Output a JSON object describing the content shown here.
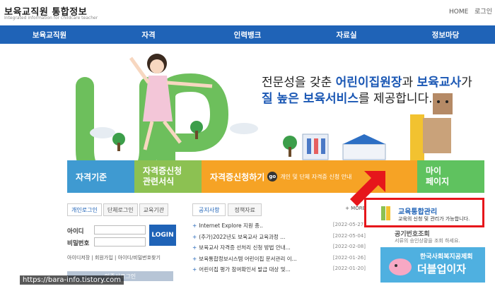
{
  "header": {
    "title": "보육교직원 통합정보",
    "subtitle": "Integrated information for childcare teacher",
    "links": [
      "HOME",
      "로그인"
    ]
  },
  "nav": {
    "items": [
      "보육교직원",
      "자격",
      "인력뱅크",
      "자료실",
      "정보마당"
    ]
  },
  "hero": {
    "line1_pre": "전문성을 갖춘 ",
    "line1_b1": "어린이집원장",
    "line1_mid": "과 ",
    "line1_b2": "보육교사",
    "line1_post": "가",
    "line2_b": "질 높은 보육서비스",
    "line2_post": "를 제공합니다."
  },
  "tabs": {
    "tab1": "자격기준",
    "tab2_line1": "자격증신청",
    "tab2_line2": "관련서식",
    "tab3": "자격증신청하기",
    "tab3_go": "go",
    "tab3_small": "개인 및 단체 자격증 신청 안내",
    "tab4_line1": "마이",
    "tab4_line2": "페이지"
  },
  "login": {
    "tabs": [
      "개인로그인",
      "단체로그인",
      "교육기관"
    ],
    "id_label": "아이디",
    "pw_label": "비밀번호",
    "button": "LOGIN",
    "links": "아이디저장 | 회원가입 | 아이디/비밀번호찾기",
    "cert_button": "인증서로그인"
  },
  "notices": {
    "tabs": [
      "공지사항",
      "정책자료"
    ],
    "more": "+ MORE",
    "items": [
      {
        "title": "Internet Explore 지원 종..",
        "date": "[2022-05-27]"
      },
      {
        "title": "(추가)2022년도 보육교사 교육과정 ...",
        "date": "[2022-05-04]"
      },
      {
        "title": "보육교사 자격증 선처리 신청 방법 안내...",
        "date": "[2022-02-08]"
      },
      {
        "title": "보육통합정보시스템 어린이집 문서관리 이...",
        "date": "[2022-01-26]"
      },
      {
        "title": "어린이집 평가 참여확인서 발급 대상 및...",
        "date": "[2022-01-20]"
      }
    ]
  },
  "right": {
    "edu_title": "교육통합관리",
    "edu_desc": "교육의 신청 및 관리가 가능합니다.",
    "sub_title": "공기번호조회",
    "sub_desc": "서류의 승인상황을 조회 하세요.",
    "fund_line1": "한국사회복지공제회",
    "fund_line2": "더블업이자"
  },
  "watermark": "https://bara-info.tistory.com",
  "colors": {
    "nav": "#1f63b7",
    "tab1": "#3f9ad1",
    "tab2": "#8cc152",
    "tab3": "#f6a325",
    "tab4": "#5fc25f",
    "highlight": "#e6161b"
  }
}
